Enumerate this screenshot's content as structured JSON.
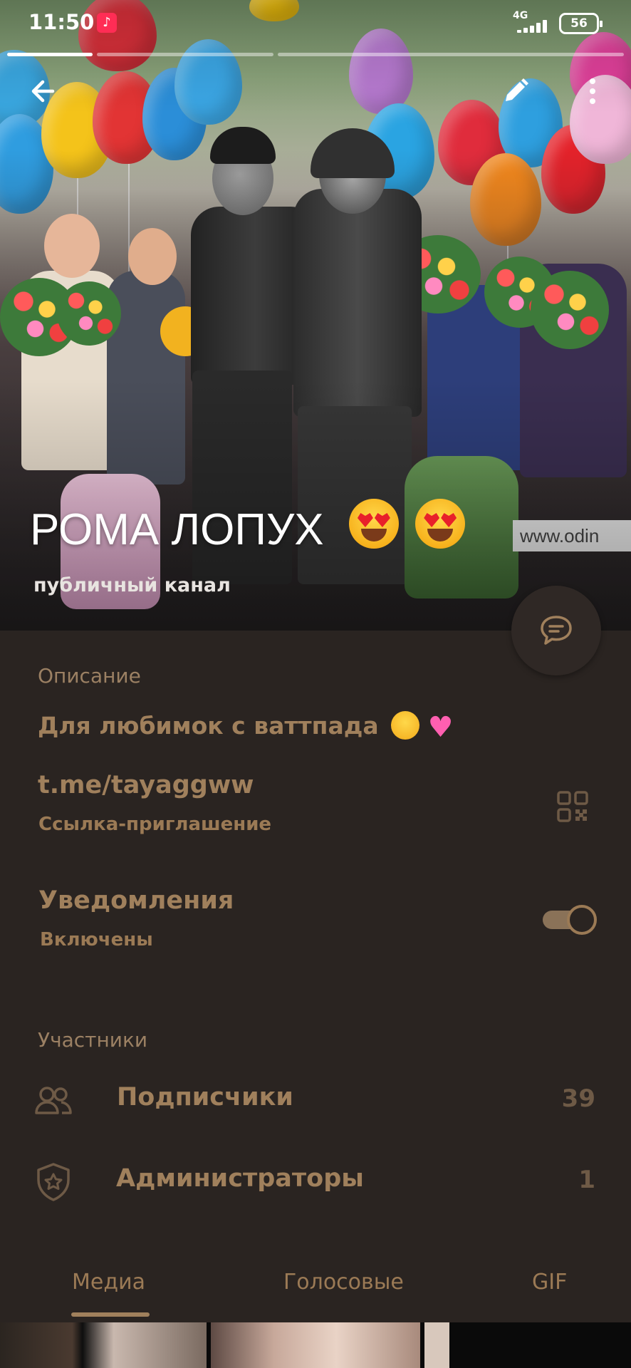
{
  "status_bar": {
    "time": "11:50",
    "network": "4G",
    "battery": "56",
    "app_icon": "tiktok-icon"
  },
  "header": {
    "back_icon": "back-arrow-icon",
    "edit_icon": "pencil-icon",
    "menu_icon": "more-vertical-icon",
    "title": "РОМА ЛОПУХ",
    "title_emoji": "heart-eyes-emoji",
    "subtitle": "публичный канал",
    "story_segments": 3
  },
  "fab": {
    "icon": "chat-icon"
  },
  "info": {
    "description_label": "Описание",
    "description": "Для любимок с ваттпада",
    "description_emoji": "pleading-face-emoji pink-heart-emoji",
    "link": "t.me/tayaggww",
    "link_label": "Ссылка-приглашение",
    "notifications_title": "Уведомления",
    "notifications_status": "Включены",
    "notifications_enabled": true
  },
  "participants": {
    "section_label": "Участники",
    "subscribers_label": "Подписчики",
    "subscribers_count": "39",
    "admins_label": "Администраторы",
    "admins_count": "1"
  },
  "tabs": [
    {
      "label": "Медиа",
      "active": true
    },
    {
      "label": "Голосовые",
      "active": false
    },
    {
      "label": "GIF",
      "active": false
    }
  ],
  "colors": {
    "background": "#2a2421",
    "accent": "#a0805c",
    "muted": "#9b8063"
  }
}
